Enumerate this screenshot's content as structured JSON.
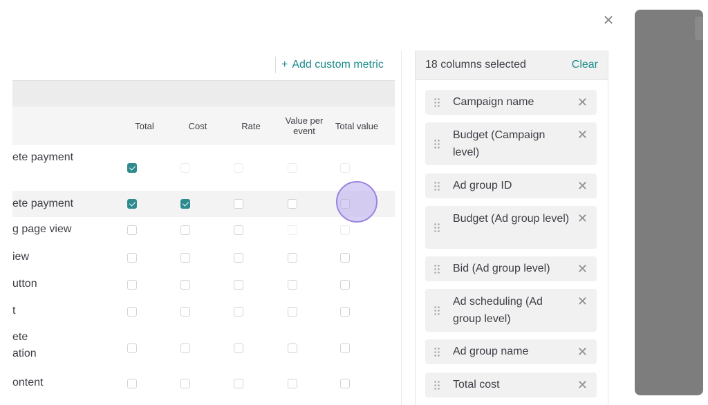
{
  "dialog": {
    "close_icon": "close-icon"
  },
  "toolbar": {
    "add_metric_plus": "+",
    "add_metric_label": "Add custom metric"
  },
  "table": {
    "columns": [
      "Total",
      "Cost",
      "Rate",
      "Value per event",
      "Total value"
    ],
    "rows": [
      {
        "label": "ete payment",
        "cells": [
          "checked",
          "faint",
          "faint",
          "faint",
          "faint"
        ]
      },
      {
        "label": "ete payment",
        "cells": [
          "checked",
          "checked",
          "empty",
          "empty",
          "empty"
        ]
      },
      {
        "label": "g page view",
        "cells": [
          "empty",
          "empty",
          "empty",
          "faint",
          "faint"
        ]
      },
      {
        "label": "iew",
        "cells": [
          "empty",
          "empty",
          "empty",
          "empty",
          "empty"
        ]
      },
      {
        "label": "utton",
        "cells": [
          "empty",
          "empty",
          "empty",
          "empty",
          "empty"
        ]
      },
      {
        "label": "t",
        "cells": [
          "empty",
          "empty",
          "empty",
          "empty",
          "empty"
        ]
      },
      {
        "label": "ete\nation",
        "cells": [
          "empty",
          "empty",
          "empty",
          "empty",
          "empty"
        ]
      },
      {
        "label": "ontent",
        "cells": [
          "empty",
          "empty",
          "empty",
          "empty",
          "empty"
        ]
      }
    ]
  },
  "selected_panel": {
    "count_label": "18 columns selected",
    "clear_label": "Clear",
    "items": [
      {
        "label": "Campaign name"
      },
      {
        "label": "Budget (Campaign level)"
      },
      {
        "label": "Ad group ID"
      },
      {
        "label": "Budget (Ad group level)"
      },
      {
        "label": "Bid (Ad group level)"
      },
      {
        "label": "Ad scheduling (Ad group level)"
      },
      {
        "label": "Ad group name"
      },
      {
        "label": "Total cost"
      }
    ]
  },
  "colors": {
    "accent": "#1a8a8a",
    "checkbox_checked": "#2d8a8f",
    "overlay": "#7d7d7d",
    "click_indicator": "#9a84e0"
  }
}
